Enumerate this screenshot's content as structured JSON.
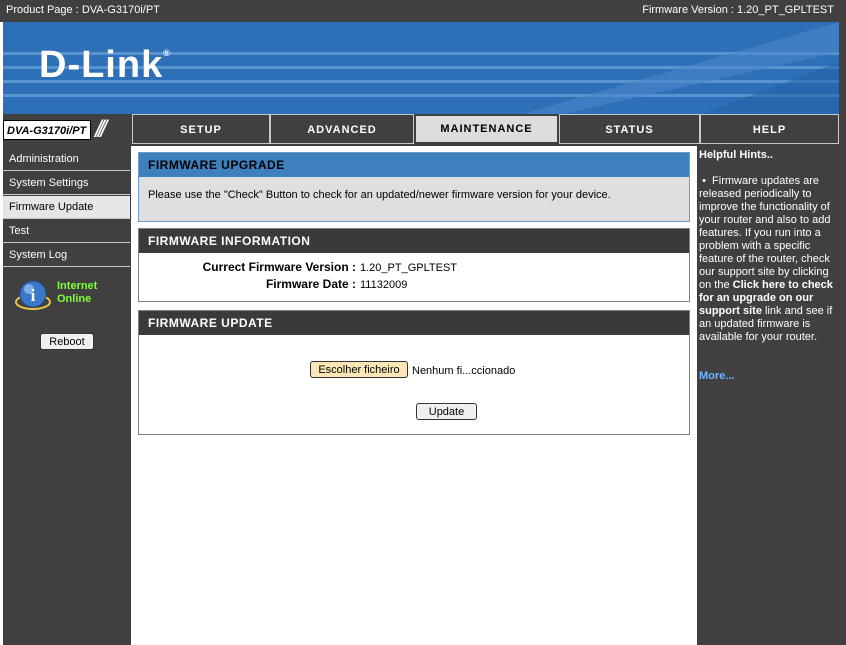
{
  "topbar": {
    "product_page": "Product Page : DVA-G3170i/PT",
    "firmware_version": "Firmware Version :  1.20_PT_GPLTEST"
  },
  "brand": {
    "logo": "D-Link",
    "reg": "®"
  },
  "nav": {
    "model": "DVA-G3170i/PT",
    "tabs": [
      {
        "label": "SETUP"
      },
      {
        "label": "ADVANCED"
      },
      {
        "label": "MAINTENANCE"
      },
      {
        "label": "STATUS"
      },
      {
        "label": "HELP"
      }
    ]
  },
  "sidebar": {
    "items": [
      {
        "label": "Administration"
      },
      {
        "label": "System Settings"
      },
      {
        "label": "Firmware Update"
      },
      {
        "label": "Test"
      },
      {
        "label": "System Log"
      }
    ],
    "status_line1": "Internet",
    "status_line2": "Online",
    "reboot_label": "Reboot"
  },
  "upgrade": {
    "title": "FIRMWARE UPGRADE",
    "desc": "Please use the \"Check\" Button to check for an updated/newer firmware version for your device."
  },
  "info": {
    "title": "FIRMWARE INFORMATION",
    "version_label": "Currect Firmware Version :",
    "version_value": "1.20_PT_GPLTEST",
    "date_label": "Firmware Date :",
    "date_value": "11132009"
  },
  "update": {
    "title": "FIRMWARE UPDATE",
    "choose_label": "Escolher ficheiro",
    "file_status": "Nenhum fi...ccionado",
    "update_label": "Update"
  },
  "hints": {
    "title": "Helpful Hints..",
    "bullet": "•",
    "text_before": "Firmware updates are released periodically to improve the functionality of your router and also to add features. If you run into a problem with a specific feature of the router, check our support site by clicking on the ",
    "link": "Click here to check for an upgrade on our support site",
    "text_after": " link and see if an updated firmware is available for your router.",
    "more": "More..."
  },
  "colors": {
    "banner": "#2d70b8",
    "nav_dark": "#404040",
    "status_green": "#7fff3a",
    "hint_link": "#6fb7ff"
  }
}
